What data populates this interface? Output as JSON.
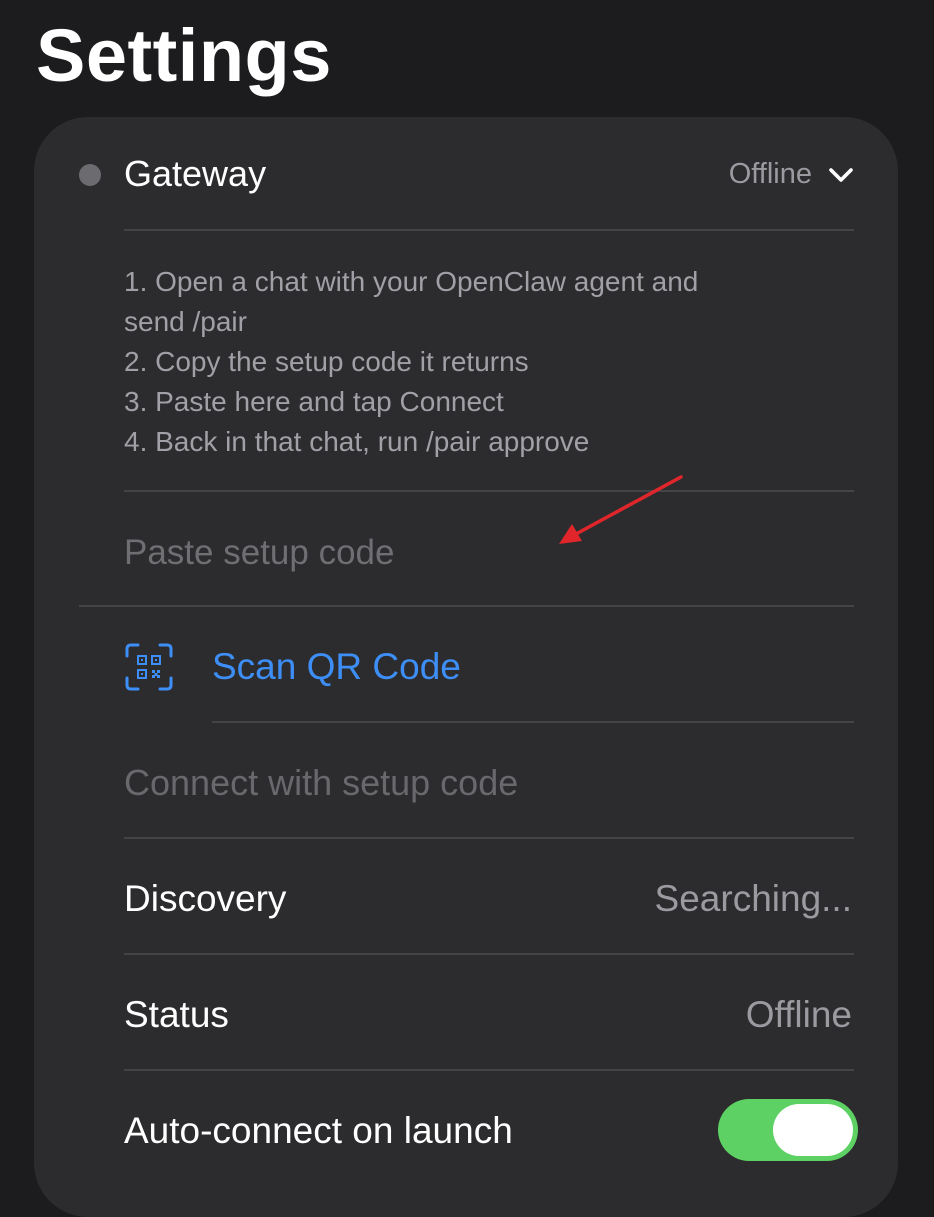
{
  "page": {
    "title": "Settings"
  },
  "gateway": {
    "title": "Gateway",
    "status": "Offline",
    "instructions": [
      "1. Open a chat with your OpenClaw agent and",
      "send /pair",
      "2. Copy the setup code it returns",
      "3. Paste here and tap Connect",
      "4. Back in that chat, run /pair approve"
    ],
    "setup_code_placeholder": "Paste setup code",
    "setup_code_value": "",
    "scan_qr_label": "Scan QR Code",
    "connect_label": "Connect with setup code"
  },
  "rows": {
    "discovery": {
      "label": "Discovery",
      "value": "Searching..."
    },
    "status": {
      "label": "Status",
      "value": "Offline"
    },
    "auto_connect": {
      "label": "Auto-connect on launch",
      "enabled": true
    }
  },
  "colors": {
    "background": "#1c1c1e",
    "card": "#2c2c2e",
    "accent_blue": "#3d8ef7",
    "toggle_on": "#5dd163",
    "annotation_arrow": "#e0262b",
    "status_dot": "#6c6c70"
  },
  "icons": {
    "chevron": "chevron-down-icon",
    "qr": "qr-code-scan-icon",
    "arrow": "annotation-arrow-icon"
  }
}
